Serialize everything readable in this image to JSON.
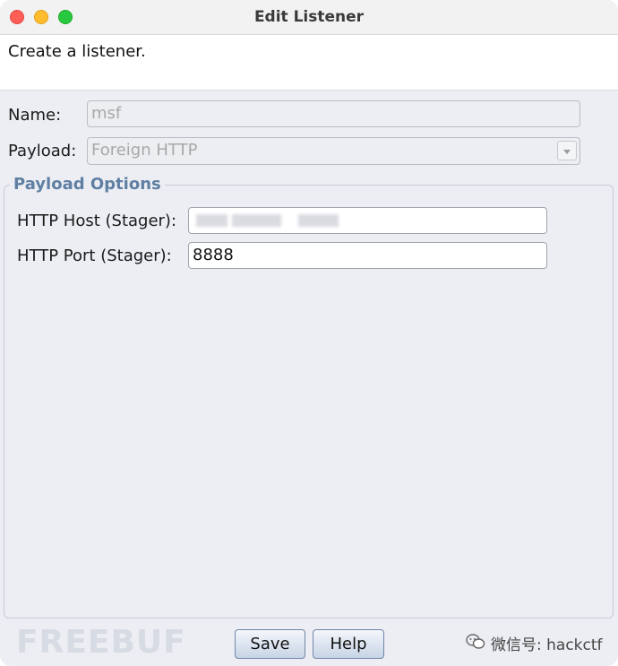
{
  "window": {
    "title": "Edit Listener"
  },
  "description": "Create a listener.",
  "form": {
    "name_label": "Name:",
    "name_value": "msf",
    "payload_label": "Payload:",
    "payload_value": "Foreign HTTP"
  },
  "payload_options": {
    "title": "Payload Options",
    "host_label": "HTTP Host (Stager):",
    "host_value": "",
    "port_label": "HTTP Port (Stager):",
    "port_value": "8888"
  },
  "buttons": {
    "save_label": "Save",
    "help_label": "Help"
  },
  "watermarks": {
    "left": "FREEBUF",
    "right": "微信号: hackctf"
  },
  "icons": {
    "close": "close-circle-icon",
    "minimize": "minimize-circle-icon",
    "maximize": "maximize-circle-icon",
    "dropdown": "chevron-down-icon",
    "wechat": "wechat-icon"
  },
  "colors": {
    "close": "#ff5f57",
    "minimize": "#febc2e",
    "maximize": "#28c840",
    "group_title": "#5f7fa3",
    "button_border": "#6f87a9"
  }
}
